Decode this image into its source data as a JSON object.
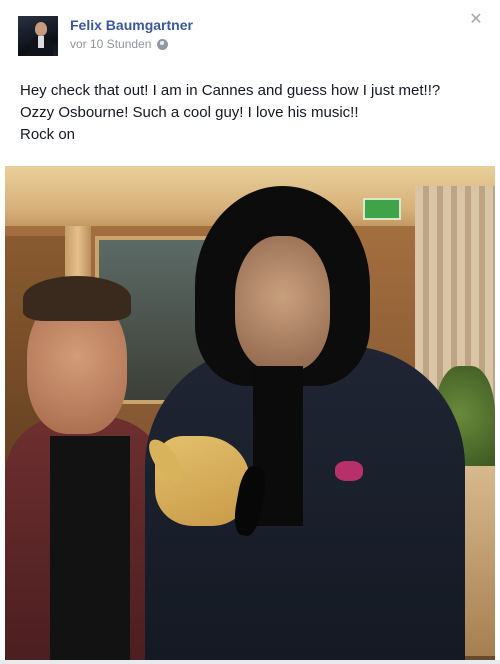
{
  "post": {
    "author": "Felix Baumgartner",
    "timestamp": "vor 10 Stunden",
    "privacy_icon": "globe-icon",
    "close_icon": "close-icon",
    "text_lines": [
      "Hey check that out! I am in Cannes and guess how I just met!!?",
      "Ozzy Osbourne! Such a cool guy! I love his music!!",
      "Rock on"
    ]
  },
  "colors": {
    "author_link": "#3b5998",
    "meta_text": "#90949c",
    "body_text": "#141823"
  }
}
